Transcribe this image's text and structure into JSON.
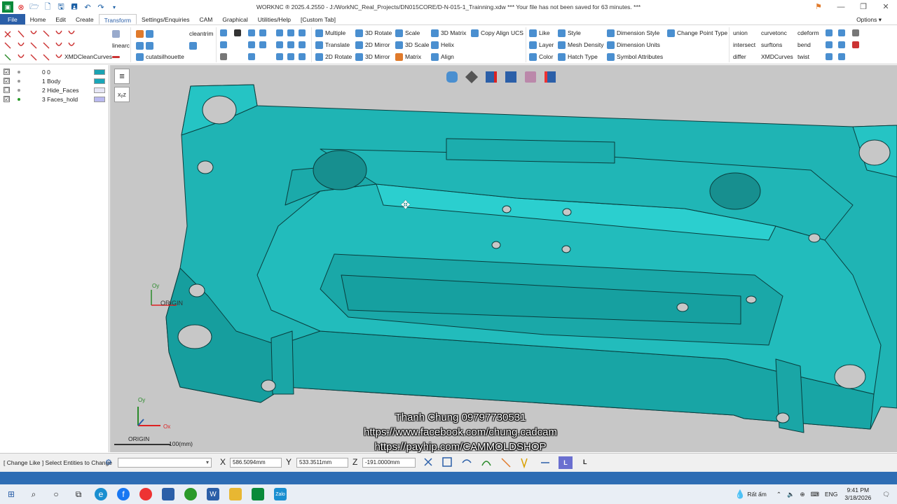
{
  "app": {
    "title": "WORKNC ® 2025.4.2550 - J:/WorkNC_Real_Projects/DN015CORE/D-N-015-1_Trainning.xdw *** Your file has not been saved for 63 minutes. ***"
  },
  "menu": {
    "tabs": [
      "File",
      "Home",
      "Edit",
      "Create",
      "Transform",
      "Settings/Enquiries",
      "CAM",
      "Graphical",
      "Utilities/Help",
      "[Custom Tab]"
    ],
    "active_tab": "Transform",
    "options_label": "Options"
  },
  "ribbon": {
    "misc": [
      "cleantrim",
      "linearc",
      "XMDCleanCurves",
      "cutatsilhouette"
    ],
    "transform": [
      "Multiple",
      "Translate",
      "2D Rotate",
      "3D Rotate",
      "2D Mirror",
      "3D Mirror",
      "Scale",
      "3D Scale",
      "Matrix",
      "3D Matrix",
      "Helix",
      "Align",
      "Copy Align UCS"
    ],
    "attributes": [
      "Like",
      "Layer",
      "Color",
      "Style",
      "Mesh Density",
      "Hatch Type",
      "Dimension Style",
      "Dimension Units",
      "Symbol Attributes",
      "Change Point Type"
    ],
    "custom": [
      "union",
      "intersect",
      "differ",
      "curvetonc",
      "surftons",
      "XMDCurves",
      "cdeform",
      "bend",
      "twist"
    ]
  },
  "layers": [
    {
      "checked": "☑",
      "num": "0",
      "name": "0",
      "color": "#1aa3b3"
    },
    {
      "checked": "☑",
      "num": "1",
      "name": "Body",
      "color": "#19a6b8"
    },
    {
      "checked": "☐",
      "num": "2",
      "name": "Hide_Faces",
      "color": "#e6e6f5"
    },
    {
      "checked": "☑",
      "num": "3",
      "name": "Faces_hold",
      "color": "#b9b9f0"
    }
  ],
  "viewport": {
    "origin_label": "ORIGIN",
    "origin_label_small": "ORIGIN",
    "ox": "Ox",
    "oy": "Oy",
    "scale_label": "100(mm)",
    "watermark": [
      "Thanh Chung 09797730531",
      "https://www.facebook.com/chung.cadcam",
      "https://payhip.com/CAMMOLDSHOP"
    ],
    "model_color": "#1fb4b4"
  },
  "status": {
    "prompt": "[ Change Like ] Select Entities to Change",
    "x_label": "X",
    "x_value": "586.5094mm",
    "y_label": "Y",
    "y_value": "533.3511mm",
    "z_label": "Z",
    "z_value": "-191.0000mm",
    "toggle_l": "L"
  },
  "taskbar": {
    "weather": "Rất ấm",
    "lang": "ENG",
    "time": "9:41 PM",
    "date": "3/18/2026"
  }
}
